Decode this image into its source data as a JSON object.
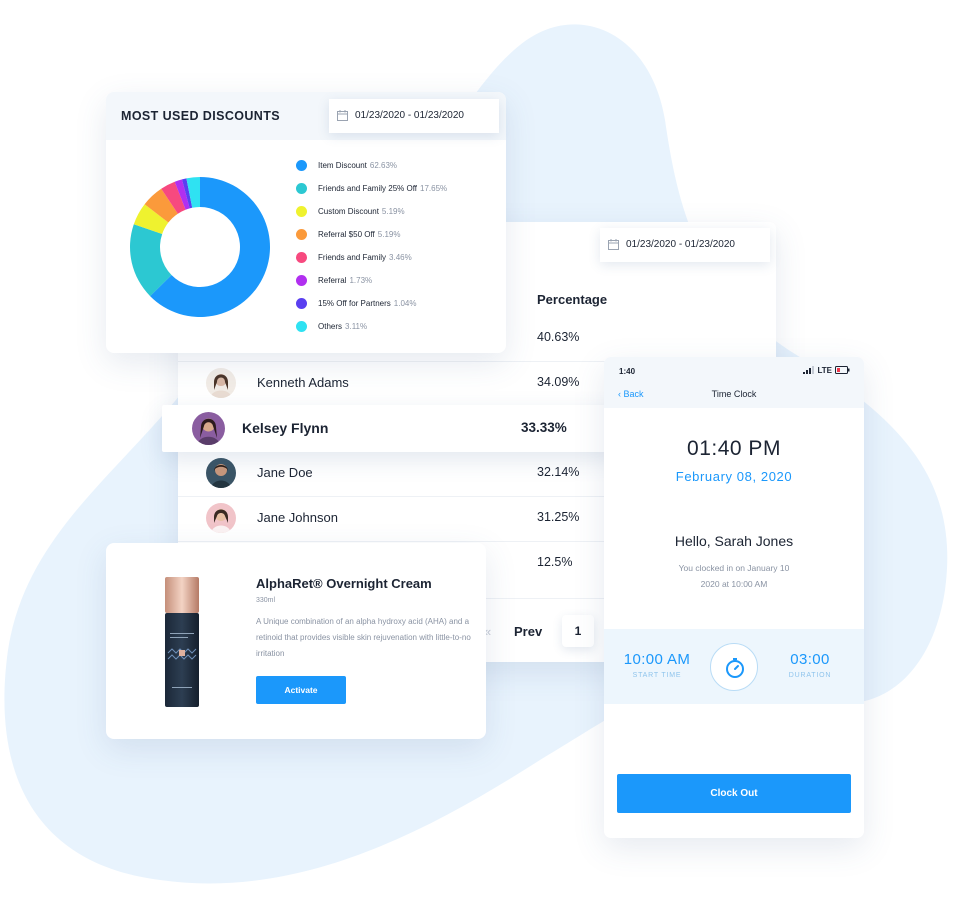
{
  "colors": {
    "accent": "#1b98fb",
    "blob": "#e8f3fd",
    "text": "#1c2433",
    "muted": "#8a93a3"
  },
  "discounts": {
    "title": "MOST USED DISCOUNTS",
    "date_range": "01/23/2020 - 01/23/2020",
    "legend": [
      {
        "label": "Item Discount",
        "pct": "62.63%",
        "color": "#1b98fb"
      },
      {
        "label": "Friends and Family 25% Off",
        "pct": "17.65%",
        "color": "#2cc8d2"
      },
      {
        "label": "Custom Discount",
        "pct": "5.19%",
        "color": "#eff22f"
      },
      {
        "label": "Referral $50 Off",
        "pct": "5.19%",
        "color": "#fb9a3b"
      },
      {
        "label": "Friends and Family",
        "pct": "3.46%",
        "color": "#f7497f"
      },
      {
        "label": "Referral",
        "pct": "1.73%",
        "color": "#b12ff0"
      },
      {
        "label": "15% Off for Partners",
        "pct": "1.04%",
        "color": "#5a3ff0"
      },
      {
        "label": "Others",
        "pct": "3.11%",
        "color": "#2fe2f2"
      }
    ]
  },
  "chart_data": {
    "type": "pie",
    "categories": [
      "Item Discount",
      "Friends and Family 25% Off",
      "Custom Discount",
      "Referral $50 Off",
      "Friends and Family",
      "Referral",
      "15% Off for Partners",
      "Others"
    ],
    "values": [
      62.63,
      17.65,
      5.19,
      5.19,
      3.46,
      1.73,
      1.04,
      3.11
    ],
    "title": "MOST USED DISCOUNTS",
    "legend_position": "right",
    "donut": true
  },
  "table": {
    "date_range": "01/23/2020 - 01/23/2020",
    "column_percentage": "Percentage",
    "first_row_pct": "40.63%",
    "rows": [
      {
        "name": "Kenneth Adams",
        "pct": "34.09%",
        "avatar_color": "#d9b8a6"
      },
      {
        "name": "Jane Doe",
        "pct": "32.14%",
        "avatar_color": "#3b5566"
      },
      {
        "name": "Jane Johnson",
        "pct": "31.25%",
        "avatar_color": "#f1c4c9"
      },
      {
        "name": "",
        "pct": "12.5%",
        "avatar_color": ""
      }
    ],
    "highlight": {
      "name": "Kelsey Flynn",
      "pct": "33.33%"
    },
    "pager_arrows": "«",
    "pager_prev": "Prev",
    "pager_page": "1"
  },
  "product": {
    "title": "AlphaRet® Overnight Cream",
    "size": "330ml",
    "description": "A Unique combination of an alpha hydroxy acid (AHA) and a retinoid that provides visible skin rejuvenation with little-to-no irritation",
    "button": "Activate"
  },
  "phone": {
    "status_time": "1:40",
    "status_network": "LTE",
    "back": "Back",
    "screen_title": "Time Clock",
    "time": "01:40 PM",
    "date": "February 08, 2020",
    "greeting": "Hello, Sarah Jones",
    "clocked_in_line1": "You clocked in on January 10",
    "clocked_in_line2": "2020 at 10:00 AM",
    "start_time": "10:00 AM",
    "start_label": "START TIME",
    "duration": "03:00",
    "duration_label": "DURATION",
    "clock_out": "Clock Out"
  }
}
